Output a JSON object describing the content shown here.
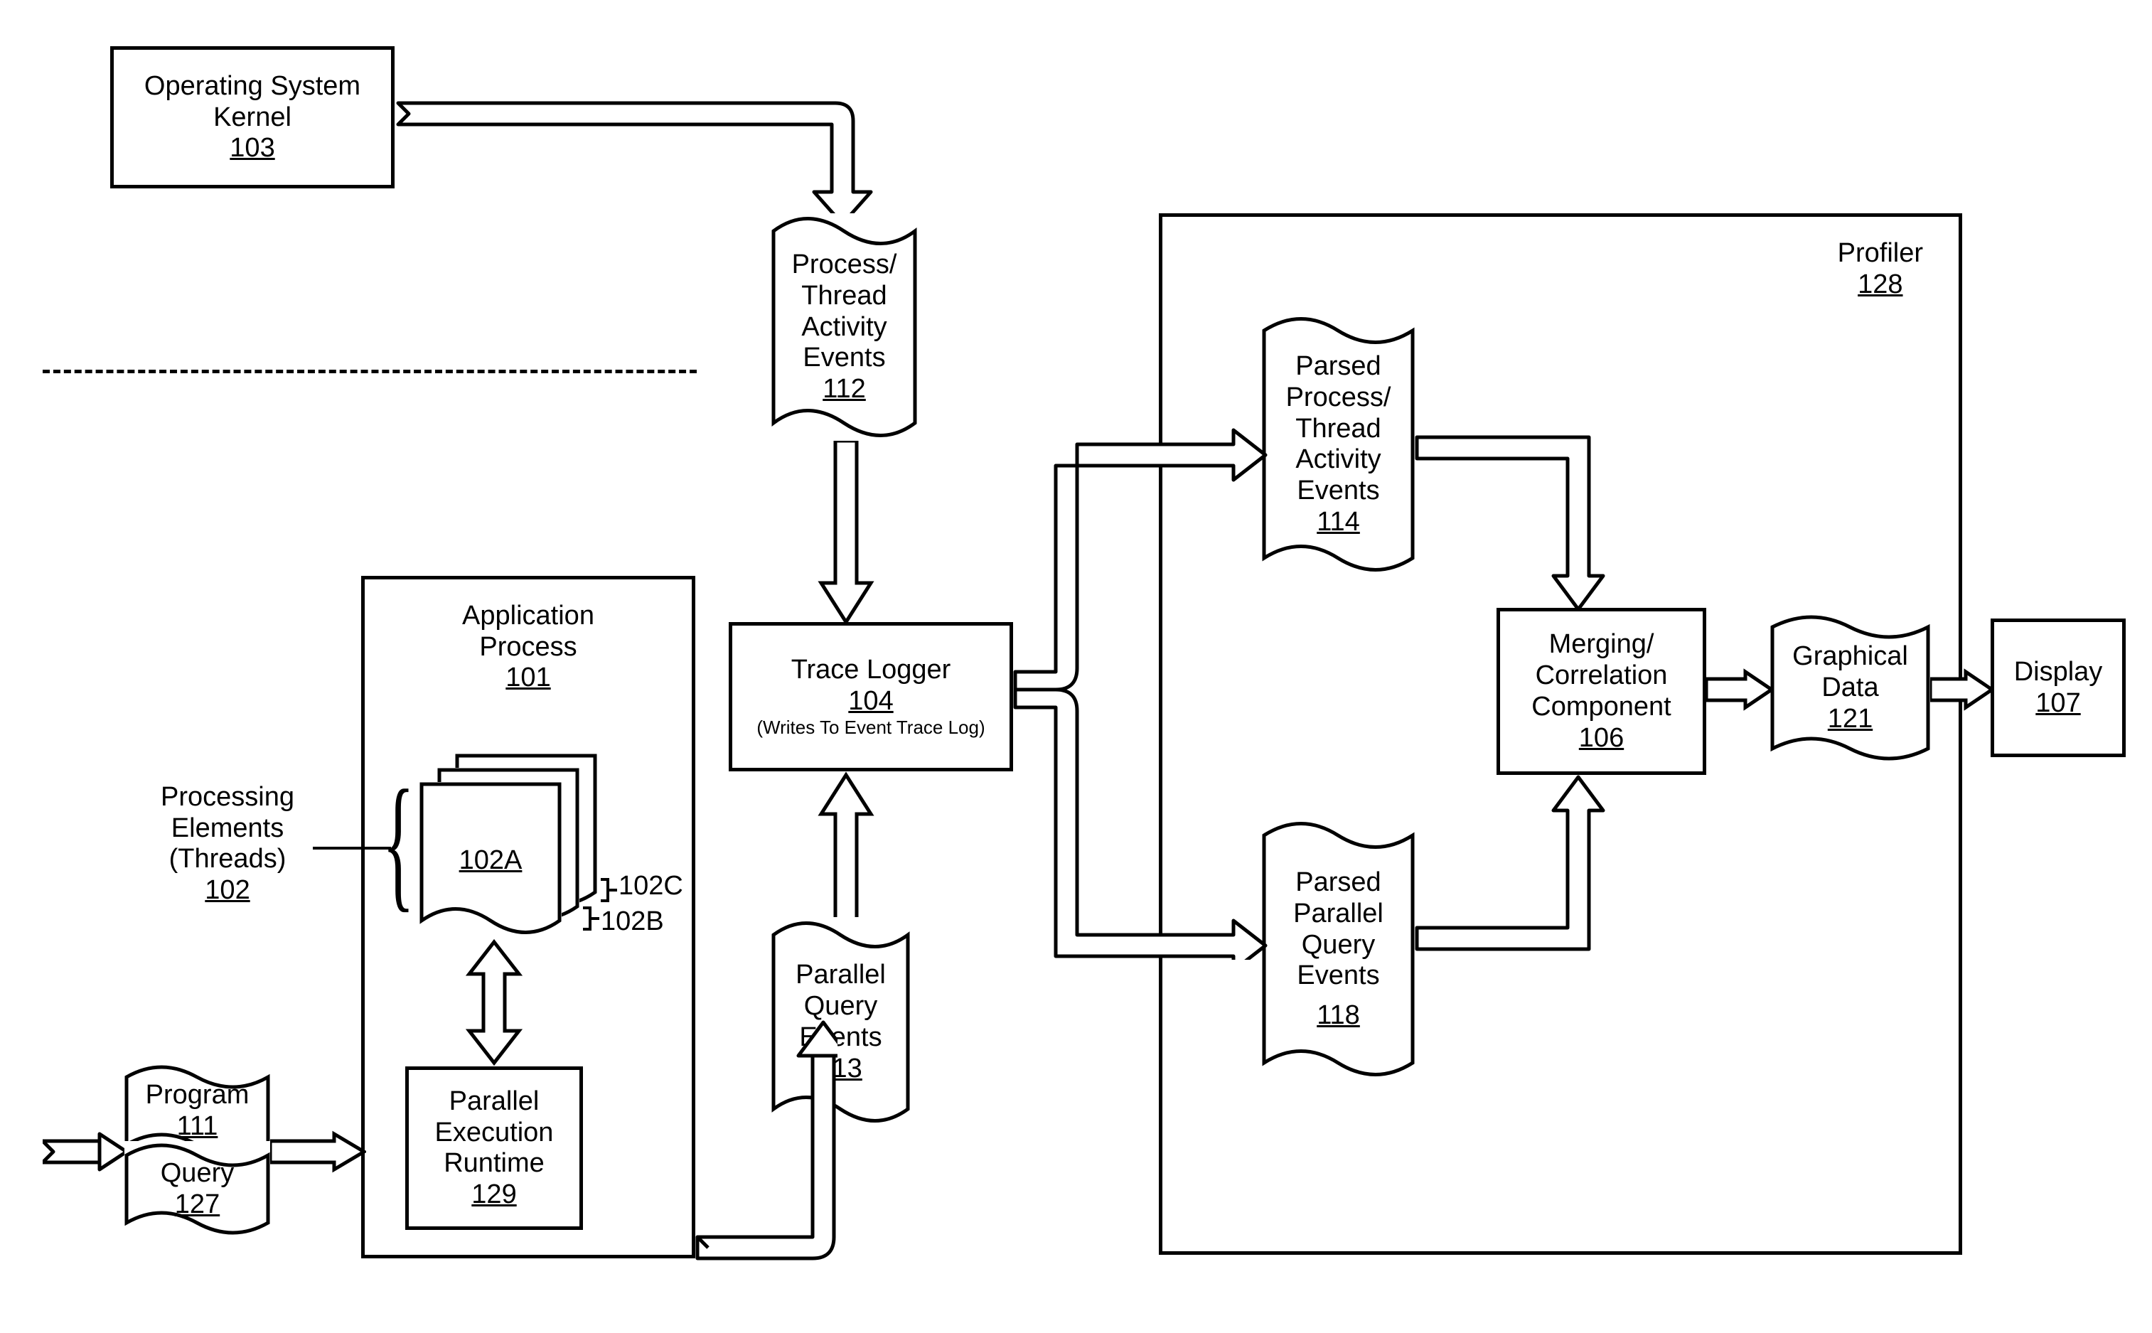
{
  "os_kernel": {
    "label": "Operating System\nKernel",
    "ref": "103"
  },
  "process_events": {
    "label": "Process/\nThread\nActivity\nEvents",
    "ref": "112"
  },
  "trace_logger": {
    "label": "Trace Logger",
    "ref": "104",
    "sub": "(Writes To Event Trace Log)"
  },
  "parallel_events": {
    "label": "Parallel\nQuery\nEvents",
    "ref": "113"
  },
  "app_process": {
    "label": "Application\nProcess",
    "ref": "101"
  },
  "parallel_runtime": {
    "label": "Parallel\nExecution\nRuntime",
    "ref": "129"
  },
  "processing_elements": {
    "label": "Processing\nElements\n(Threads)",
    "ref": "102"
  },
  "pe_a": "102A",
  "pe_b": "102B",
  "pe_c": "102C",
  "program": {
    "label": "Program",
    "ref": "111"
  },
  "query": {
    "label": "Query",
    "ref": "127"
  },
  "profiler": {
    "label": "Profiler",
    "ref": "128"
  },
  "parsed_process": {
    "label": "Parsed\nProcess/\nThread\nActivity\nEvents",
    "ref": "114"
  },
  "parsed_parallel": {
    "label": "Parsed\nParallel\nQuery\nEvents",
    "ref": "118"
  },
  "merging": {
    "label": "Merging/\nCorrelation\nComponent",
    "ref": "106"
  },
  "graphical": {
    "label": "Graphical\nData",
    "ref": "121"
  },
  "display": {
    "label": "Display",
    "ref": "107"
  }
}
